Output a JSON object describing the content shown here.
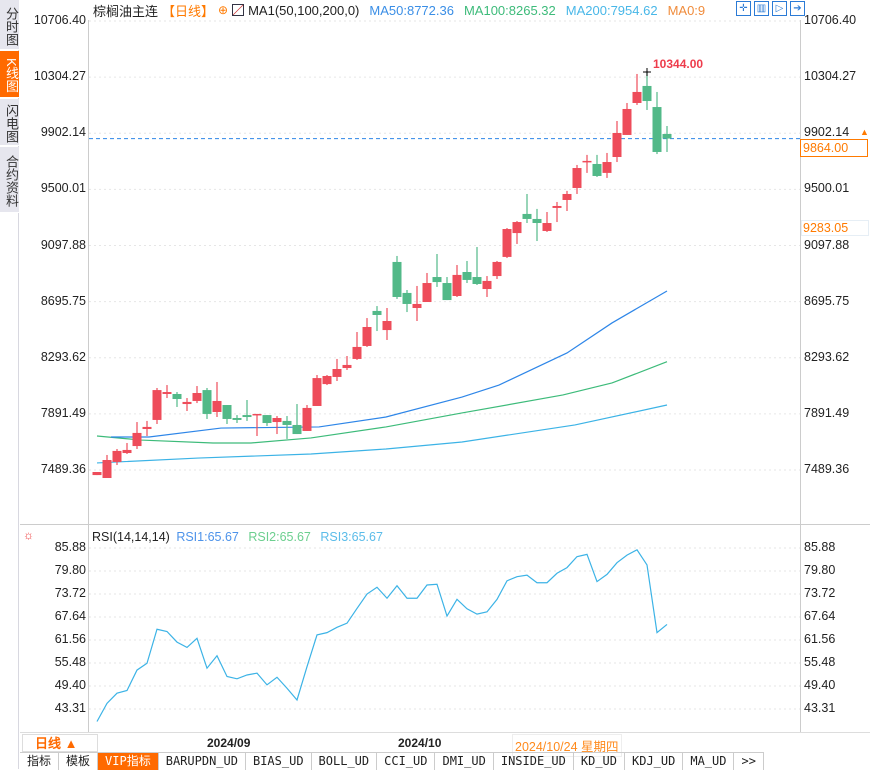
{
  "sidebar": {
    "tabs": [
      {
        "label": "分时图",
        "active": false
      },
      {
        "label": "K线图",
        "active": true
      },
      {
        "label": "闪电图",
        "active": false
      },
      {
        "label": "合约资料",
        "active": false
      }
    ]
  },
  "header": {
    "title": "棕榈油主连",
    "period": "【日线】",
    "indicator": "MA1(50,100,200,0)",
    "ma50": "MA50:8772.36",
    "ma100": "MA100:8265.32",
    "ma200": "MA200:7954.62",
    "ma0": "MA0:9",
    "tools": [
      "crosshair-icon",
      "fit-range-icon",
      "play-forward-icon",
      "exit-icon"
    ]
  },
  "colors": {
    "up": "#ee4c5a",
    "down": "#52b988",
    "ma50": "#2e86e8",
    "ma100": "#3dbb7a",
    "ma200": "#3cb3e6",
    "accent": "#ff7a00",
    "rsi": "#3cb3e6"
  },
  "price_axis": {
    "ticks": [
      "10706.40",
      "10304.27",
      "9902.14",
      "9500.01",
      "9097.88",
      "8695.75",
      "8293.62",
      "7891.49",
      "7489.36"
    ],
    "last_price": "9864.00",
    "marker_price": "9283.05",
    "high_label": "10344.00"
  },
  "rsi": {
    "title": "RSI(14,14,14)",
    "rsi1": "RSI1:65.67",
    "rsi2": "RSI2:65.67",
    "rsi3": "RSI3:65.67",
    "ticks": [
      "85.88",
      "79.80",
      "73.72",
      "67.64",
      "61.56",
      "55.48",
      "49.40",
      "43.31"
    ]
  },
  "dates": {
    "period_btn": "日线 ▲",
    "m1": "2024/09",
    "m2": "2024/10",
    "cursor": "2024/10/24 星期四"
  },
  "tabs": [
    "指标",
    "模板",
    "VIP指标",
    "BARUPDN_UD",
    "BIAS_UD",
    "BOLL_UD",
    "CCI_UD",
    "DMI_UD",
    "INSIDE_UD",
    "KD_UD",
    "KDJ_UD",
    "MA_UD",
    ">>"
  ],
  "chart_data": {
    "type": "candlestick",
    "ohlc": [
      [
        7453,
        7475,
        7453,
        7475
      ],
      [
        7432,
        7597,
        7432,
        7561
      ],
      [
        7547,
        7640,
        7525,
        7626
      ],
      [
        7611,
        7683,
        7604,
        7633
      ],
      [
        7661,
        7833,
        7640,
        7755
      ],
      [
        7783,
        7841,
        7733,
        7798
      ],
      [
        7848,
        8077,
        7819,
        8062
      ],
      [
        8034,
        8098,
        8005,
        8048
      ],
      [
        8034,
        8048,
        7941,
        7998
      ],
      [
        7962,
        8005,
        7912,
        7977
      ],
      [
        7984,
        8091,
        7969,
        8041
      ],
      [
        8062,
        8077,
        7855,
        7891
      ],
      [
        7905,
        8120,
        7869,
        7984
      ],
      [
        7955,
        7955,
        7819,
        7855
      ],
      [
        7862,
        7883,
        7826,
        7848
      ],
      [
        7883,
        7991,
        7841,
        7869
      ],
      [
        7883,
        7891,
        7733,
        7891
      ],
      [
        7883,
        7883,
        7805,
        7826
      ],
      [
        7833,
        7876,
        7747,
        7862
      ],
      [
        7841,
        7876,
        7712,
        7812
      ],
      [
        7812,
        7962,
        7747,
        7747
      ],
      [
        7769,
        7955,
        7769,
        7934
      ],
      [
        7948,
        8170,
        7948,
        8148
      ],
      [
        8105,
        8170,
        8098,
        8163
      ],
      [
        8156,
        8285,
        8127,
        8213
      ],
      [
        8220,
        8306,
        8206,
        8242
      ],
      [
        8285,
        8478,
        8278,
        8371
      ],
      [
        8378,
        8578,
        8371,
        8514
      ],
      [
        8629,
        8664,
        8485,
        8600
      ],
      [
        8492,
        8650,
        8421,
        8557
      ],
      [
        8980,
        9023,
        8715,
        8729
      ],
      [
        8758,
        8779,
        8621,
        8679
      ],
      [
        8650,
        8808,
        8557,
        8679
      ],
      [
        8693,
        8901,
        8693,
        8829
      ],
      [
        8872,
        9037,
        8801,
        8836
      ],
      [
        8829,
        8872,
        8707,
        8707
      ],
      [
        8736,
        8958,
        8729,
        8887
      ],
      [
        8908,
        8987,
        8829,
        8851
      ],
      [
        8872,
        9087,
        8815,
        8822
      ],
      [
        8786,
        8879,
        8729,
        8844
      ],
      [
        8879,
        8987,
        8858,
        8980
      ],
      [
        9016,
        9223,
        9008,
        9216
      ],
      [
        9187,
        9273,
        9109,
        9266
      ],
      [
        9324,
        9467,
        9259,
        9288
      ],
      [
        9288,
        9360,
        9130,
        9259
      ],
      [
        9202,
        9338,
        9195,
        9259
      ],
      [
        9367,
        9410,
        9266,
        9381
      ],
      [
        9424,
        9489,
        9345,
        9467
      ],
      [
        9510,
        9675,
        9467,
        9653
      ],
      [
        9696,
        9747,
        9618,
        9704
      ],
      [
        9682,
        9747,
        9589,
        9596
      ],
      [
        9618,
        9761,
        9582,
        9696
      ],
      [
        9732,
        9990,
        9696,
        9904
      ],
      [
        9890,
        10119,
        9890,
        10076
      ],
      [
        10119,
        10327,
        10105,
        10198
      ],
      [
        10241,
        10344,
        10069,
        10133
      ],
      [
        10090,
        10198,
        9753,
        9768
      ],
      [
        9897,
        9954,
        9768,
        9864
      ]
    ],
    "ma50": [
      [
        1.4,
        7726
      ],
      [
        5.2,
        7726
      ],
      [
        12.4,
        7790
      ],
      [
        22.2,
        7798
      ],
      [
        28.9,
        7869
      ],
      [
        36.5,
        8012
      ],
      [
        40.2,
        8098
      ],
      [
        47,
        8328
      ],
      [
        51.5,
        8543
      ],
      [
        57,
        8772
      ]
    ],
    "ma100": [
      [
        0,
        7733
      ],
      [
        4.4,
        7704
      ],
      [
        11.6,
        7683
      ],
      [
        15.4,
        7683
      ],
      [
        21.4,
        7719
      ],
      [
        28.9,
        7798
      ],
      [
        36.5,
        7898
      ],
      [
        46.6,
        8027
      ],
      [
        51.5,
        8113
      ],
      [
        57,
        8265
      ]
    ],
    "ma200": [
      [
        0,
        7540
      ],
      [
        10.1,
        7575
      ],
      [
        21.4,
        7604
      ],
      [
        28.9,
        7640
      ],
      [
        36.5,
        7690
      ],
      [
        47.8,
        7812
      ],
      [
        57,
        7955
      ]
    ],
    "rsi1": [
      40.0,
      44.8,
      47.5,
      48.2,
      53.6,
      55.4,
      64.4,
      63.8,
      61.0,
      59.6,
      62.0,
      54.1,
      57.4,
      51.9,
      51.3,
      52.3,
      52.8,
      49.7,
      51.7,
      48.8,
      45.7,
      54.5,
      62.9,
      63.5,
      64.9,
      66.0,
      69.9,
      73.7,
      75.5,
      72.6,
      75.9,
      72.6,
      72.6,
      76.1,
      76.3,
      67.9,
      72.3,
      69.8,
      68.4,
      69.0,
      72.3,
      77.2,
      78.3,
      78.7,
      76.7,
      76.7,
      79.2,
      80.7,
      83.6,
      84.2,
      77.0,
      78.9,
      82.0,
      84.0,
      85.4,
      81.4,
      63.5,
      65.67
    ],
    "ylim": [
      7489.36,
      10706.4
    ],
    "rsi_ylim": [
      43.31,
      85.88
    ]
  }
}
